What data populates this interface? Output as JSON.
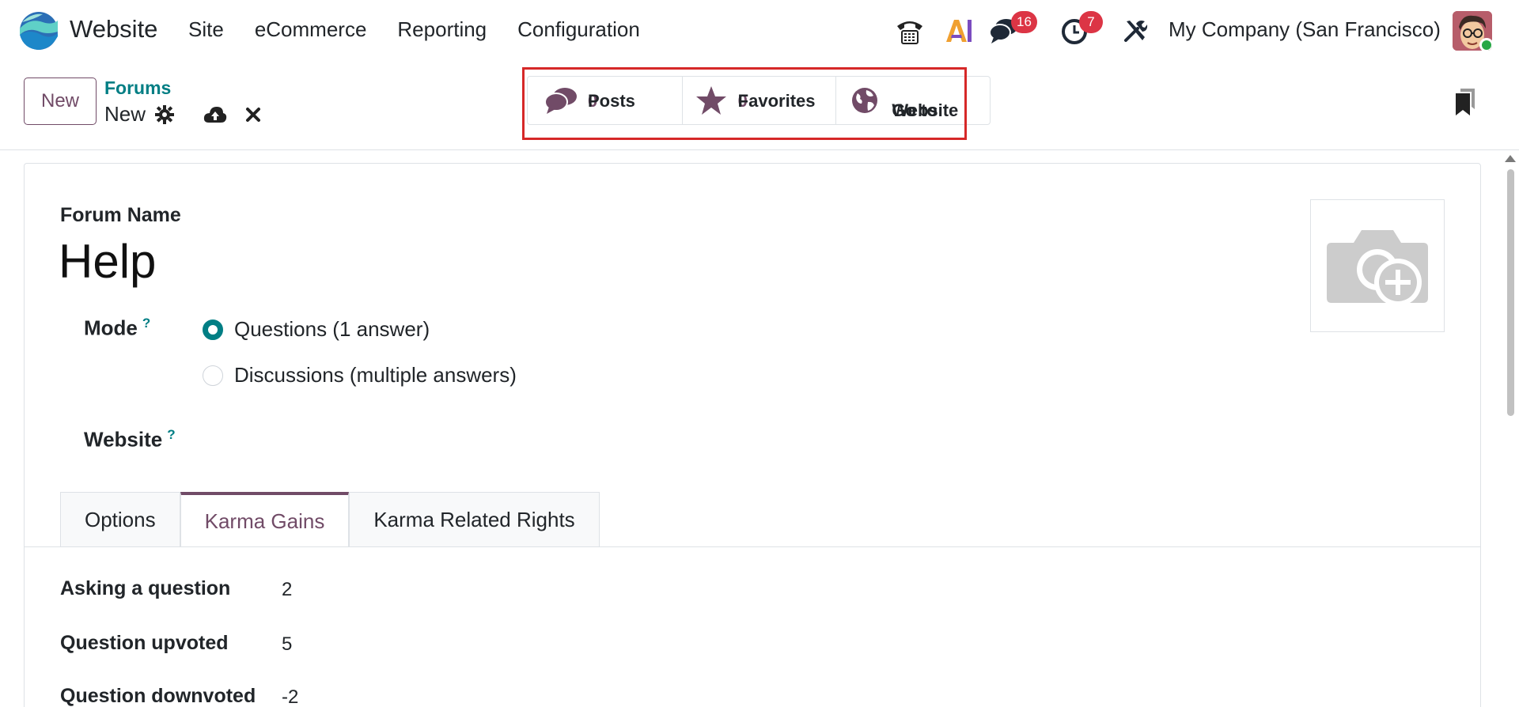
{
  "app": {
    "name": "Website"
  },
  "menu": {
    "items": [
      "Site",
      "eCommerce",
      "Reporting",
      "Configuration"
    ]
  },
  "systray": {
    "messages_count": "16",
    "activities_count": "7",
    "company": "My Company (San Francisco)",
    "icons": [
      "phone-icon",
      "ai-icon",
      "chat-icon",
      "clock-icon",
      "tools-icon"
    ]
  },
  "control": {
    "new_label": "New",
    "breadcrumb_parent": "Forums",
    "breadcrumb_current": "New"
  },
  "smart_buttons": [
    {
      "label": "Posts",
      "value": "0"
    },
    {
      "label": "Favorites",
      "value": "0"
    },
    {
      "label_line1": "Go to",
      "label_line2": "Website"
    }
  ],
  "form": {
    "title_label": "Forum Name",
    "title_value": "Help",
    "mode_label": "Mode",
    "help_mark": "?",
    "mode_options": [
      "Questions (1 answer)",
      "Discussions (multiple answers)"
    ],
    "mode_selected": 0,
    "website_label": "Website"
  },
  "tabs": [
    "Options",
    "Karma Gains",
    "Karma Related Rights"
  ],
  "active_tab": 1,
  "karma_rows": [
    {
      "label": "Asking a question",
      "value": "2"
    },
    {
      "label": "Question upvoted",
      "value": "5"
    },
    {
      "label": "Question downvoted",
      "value": "-2"
    }
  ],
  "colors": {
    "brand": "#714b67",
    "accent": "#017e84",
    "highlight": "#d62828",
    "badge": "#dc3545"
  }
}
